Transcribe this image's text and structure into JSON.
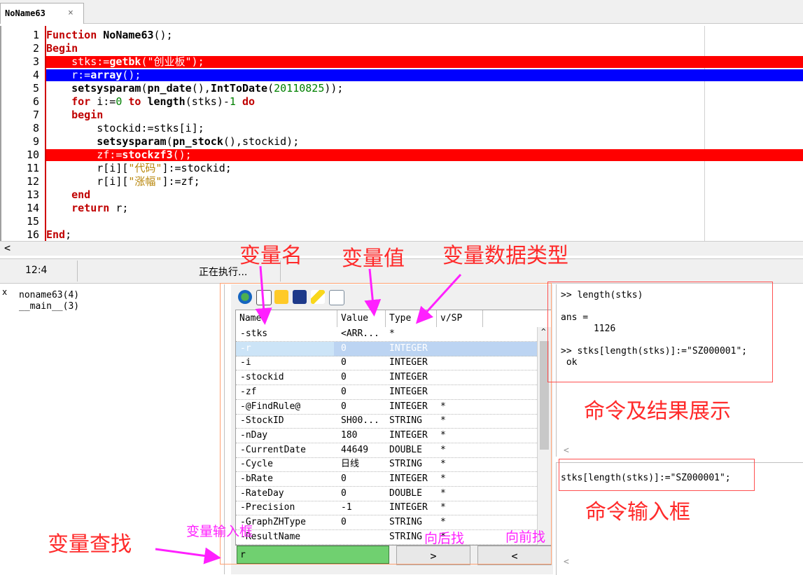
{
  "tab": {
    "label": "NoName63",
    "close": "×"
  },
  "editor": {
    "lines": [
      {
        "n": "1",
        "segs": [
          {
            "t": "Function ",
            "c": "kw"
          },
          {
            "t": "NoName63",
            "c": "fn"
          },
          {
            "t": "();",
            "c": ""
          }
        ]
      },
      {
        "n": "2",
        "segs": [
          {
            "t": "Begin",
            "c": "kw"
          }
        ]
      },
      {
        "n": "3",
        "segs": [
          {
            "t": "    stks:=",
            "c": "white"
          },
          {
            "t": "getbk",
            "c": "white fn"
          },
          {
            "t": "(\"创业板\");",
            "c": "white"
          }
        ],
        "hl": "#ff0000"
      },
      {
        "n": "4",
        "segs": [
          {
            "t": "    r:=",
            "c": "white"
          },
          {
            "t": "array",
            "c": "white fn"
          },
          {
            "t": "();",
            "c": "white"
          }
        ],
        "hl": "#0000ff"
      },
      {
        "n": "5",
        "segs": [
          {
            "t": "    ",
            "c": ""
          },
          {
            "t": "setsysparam",
            "c": "fn"
          },
          {
            "t": "(",
            "c": ""
          },
          {
            "t": "pn_date",
            "c": "fn"
          },
          {
            "t": "(),",
            "c": ""
          },
          {
            "t": "IntToDate",
            "c": "fn"
          },
          {
            "t": "(",
            "c": ""
          },
          {
            "t": "20110825",
            "c": "num"
          },
          {
            "t": "));",
            "c": ""
          }
        ]
      },
      {
        "n": "6",
        "segs": [
          {
            "t": "    ",
            "c": ""
          },
          {
            "t": "for",
            "c": "kw"
          },
          {
            "t": " i:=",
            "c": ""
          },
          {
            "t": "0",
            "c": "num"
          },
          {
            "t": " ",
            "c": ""
          },
          {
            "t": "to",
            "c": "kw"
          },
          {
            "t": " ",
            "c": ""
          },
          {
            "t": "length",
            "c": "fn"
          },
          {
            "t": "(stks)-",
            "c": ""
          },
          {
            "t": "1",
            "c": "num"
          },
          {
            "t": " ",
            "c": ""
          },
          {
            "t": "do",
            "c": "kw"
          }
        ]
      },
      {
        "n": "7",
        "segs": [
          {
            "t": "    ",
            "c": ""
          },
          {
            "t": "begin",
            "c": "kw"
          }
        ]
      },
      {
        "n": "8",
        "segs": [
          {
            "t": "        stockid:=stks[i];",
            "c": ""
          }
        ]
      },
      {
        "n": "9",
        "segs": [
          {
            "t": "        ",
            "c": ""
          },
          {
            "t": "setsysparam",
            "c": "fn"
          },
          {
            "t": "(",
            "c": ""
          },
          {
            "t": "pn_stock",
            "c": "fn"
          },
          {
            "t": "(),stockid);",
            "c": ""
          }
        ]
      },
      {
        "n": "10",
        "segs": [
          {
            "t": "        zf:=",
            "c": "white"
          },
          {
            "t": "stockzf3",
            "c": "white fn"
          },
          {
            "t": "();",
            "c": "white"
          }
        ],
        "hl": "#ff0000"
      },
      {
        "n": "11",
        "segs": [
          {
            "t": "        r[i][",
            "c": ""
          },
          {
            "t": "\"代码\"",
            "c": "str"
          },
          {
            "t": "]:=stockid;",
            "c": ""
          }
        ]
      },
      {
        "n": "12",
        "segs": [
          {
            "t": "        r[i][",
            "c": ""
          },
          {
            "t": "\"涨幅\"",
            "c": "str"
          },
          {
            "t": "]:=zf;",
            "c": ""
          }
        ]
      },
      {
        "n": "13",
        "segs": [
          {
            "t": "    ",
            "c": ""
          },
          {
            "t": "end",
            "c": "kw"
          }
        ]
      },
      {
        "n": "14",
        "segs": [
          {
            "t": "    ",
            "c": ""
          },
          {
            "t": "return",
            "c": "kw"
          },
          {
            "t": " r;",
            "c": ""
          }
        ]
      },
      {
        "n": "15",
        "segs": []
      },
      {
        "n": "16",
        "segs": [
          {
            "t": "End",
            "c": "kw"
          },
          {
            "t": ";",
            "c": ""
          }
        ]
      }
    ]
  },
  "hscroll": {
    "left_arrow": "<"
  },
  "status": {
    "position": "12:4",
    "message": "正在执行..."
  },
  "callstack": {
    "close": "x",
    "items": [
      "noname63(4)",
      "__main__(3)"
    ]
  },
  "watch": {
    "columns": [
      "Name",
      "Value",
      "Type",
      "v/SP"
    ],
    "rows": [
      {
        "name": "stks",
        "value": "<ARR...",
        "type": "*",
        "vsp": ""
      },
      {
        "name": "r",
        "value": "0",
        "type": "INTEGER",
        "vsp": "",
        "selected": true
      },
      {
        "name": "i",
        "value": "0",
        "type": "INTEGER",
        "vsp": ""
      },
      {
        "name": "stockid",
        "value": "0",
        "type": "INTEGER",
        "vsp": ""
      },
      {
        "name": "zf",
        "value": "0",
        "type": "INTEGER",
        "vsp": ""
      },
      {
        "name": "@FindRule@",
        "value": "0",
        "type": "INTEGER",
        "vsp": "*"
      },
      {
        "name": "StockID",
        "value": "SH00...",
        "type": "STRING",
        "vsp": "*"
      },
      {
        "name": "nDay",
        "value": "180",
        "type": "INTEGER",
        "vsp": "*"
      },
      {
        "name": "CurrentDate",
        "value": "44649",
        "type": "DOUBLE",
        "vsp": "*"
      },
      {
        "name": "Cycle",
        "value": "日线",
        "type": "STRING",
        "vsp": "*"
      },
      {
        "name": "bRate",
        "value": "0",
        "type": "INTEGER",
        "vsp": "*"
      },
      {
        "name": "RateDay",
        "value": "0",
        "type": "DOUBLE",
        "vsp": "*"
      },
      {
        "name": "Precision",
        "value": "-1",
        "type": "INTEGER",
        "vsp": "*"
      },
      {
        "name": "GraphZHType",
        "value": "0",
        "type": "STRING",
        "vsp": "*"
      },
      {
        "name": "ResultName",
        "value": "",
        "type": "STRING",
        "vsp": "*"
      }
    ],
    "scroll_up": "^",
    "search_value": "r",
    "next_button": ">",
    "prev_button": "<"
  },
  "console": {
    "output": [
      ">> length(stks)",
      "",
      "ans =",
      "      1126",
      "",
      ">> stks[length(stks)]:=\"SZ000001\";",
      " ok"
    ],
    "output_scroll_left": "<",
    "input": "stks[length(stks)]:=\"SZ000001\";",
    "input_scroll_left": "<"
  },
  "annotations": {
    "var_name": "变量名",
    "var_value": "变量值",
    "var_type": "变量数据类型",
    "cmd_result": "命令及结果展示",
    "cmd_input": "命令输入框",
    "var_search": "变量查找",
    "var_input_box": "变量输入框",
    "search_back": "向后找",
    "search_forward": "向前找"
  },
  "colors": {
    "annotation_red": "#ff2a2a",
    "annotation_pink": "#ff20ff",
    "highlight_red": "#ff0000",
    "highlight_blue": "#0000ff",
    "search_green": "#70d070"
  }
}
